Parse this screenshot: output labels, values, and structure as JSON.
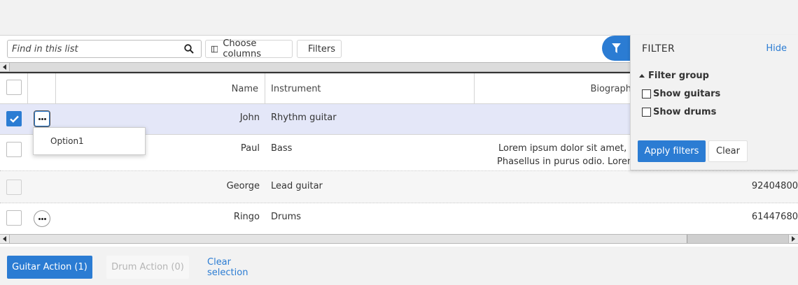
{
  "toolbar": {
    "search_placeholder": "Find in this list",
    "choose_columns_label": "Choose columns",
    "filters_label": "Filters"
  },
  "table": {
    "columns": [
      "Name",
      "Instrument",
      "Biograph"
    ],
    "rows": [
      {
        "name": "John",
        "instrument": "Rhythm guitar",
        "bio_line1": "",
        "bio_line2": "",
        "extra": "",
        "checked": true
      },
      {
        "name": "Paul",
        "instrument": "Bass",
        "bio_line1": "Lorem ipsum dolor sit amet, cor",
        "bio_line2": "Phasellus in purus odio. Lorem i",
        "extra": "",
        "checked": false
      },
      {
        "name": "George",
        "instrument": "Lead guitar",
        "bio_line1": "",
        "bio_line2": "",
        "extra": "92404800",
        "checked": false
      },
      {
        "name": "Ringo",
        "instrument": "Drums",
        "bio_line1": "",
        "bio_line2": "",
        "extra": "61447680",
        "checked": false
      }
    ]
  },
  "row_menu": {
    "items": [
      "Option1"
    ]
  },
  "filter_panel": {
    "title": "FILTER",
    "hide_label": "Hide",
    "group_label": "Filter group",
    "options": [
      {
        "label": "Show guitars",
        "checked": false
      },
      {
        "label": "Show drums",
        "checked": false
      }
    ],
    "apply_label": "Apply filters",
    "clear_label": "Clear"
  },
  "footer": {
    "guitar_action_label": "Guitar Action (1)",
    "drum_action_label": "Drum Action (0)",
    "clear_selection_label": "Clear selection"
  },
  "colors": {
    "accent": "#2b7cd3",
    "selected_row": "#e4e7f8"
  }
}
